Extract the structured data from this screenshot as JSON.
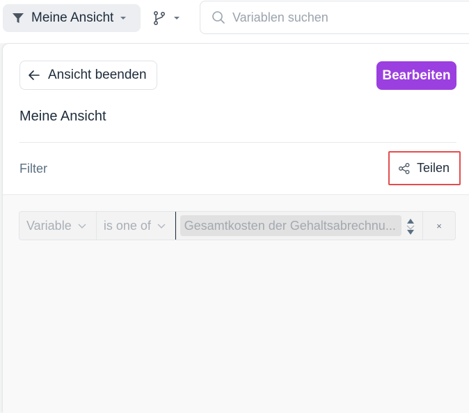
{
  "toolbar": {
    "view_label": "Meine Ansicht",
    "search_placeholder": "Variablen suchen"
  },
  "panel": {
    "back_label": "Ansicht beenden",
    "edit_label": "Bearbeiten",
    "view_title": "Meine Ansicht",
    "filter_label": "Filter",
    "share_label": "Teilen"
  },
  "filter_row": {
    "variable_label": "Variable",
    "operator_label": "is one of",
    "value_chip": "Gesamtkosten der Gehaltsabrechnu...",
    "clear_label": "×"
  },
  "colors": {
    "accent": "#9b3fe0",
    "highlight": "#e54c4c",
    "muted_text": "#5b7082"
  },
  "icons": [
    "filter-icon",
    "branch-icon",
    "search-icon",
    "arrow-left-icon",
    "share-icon",
    "chevron-down-icon",
    "stepper-icon",
    "close-icon"
  ]
}
